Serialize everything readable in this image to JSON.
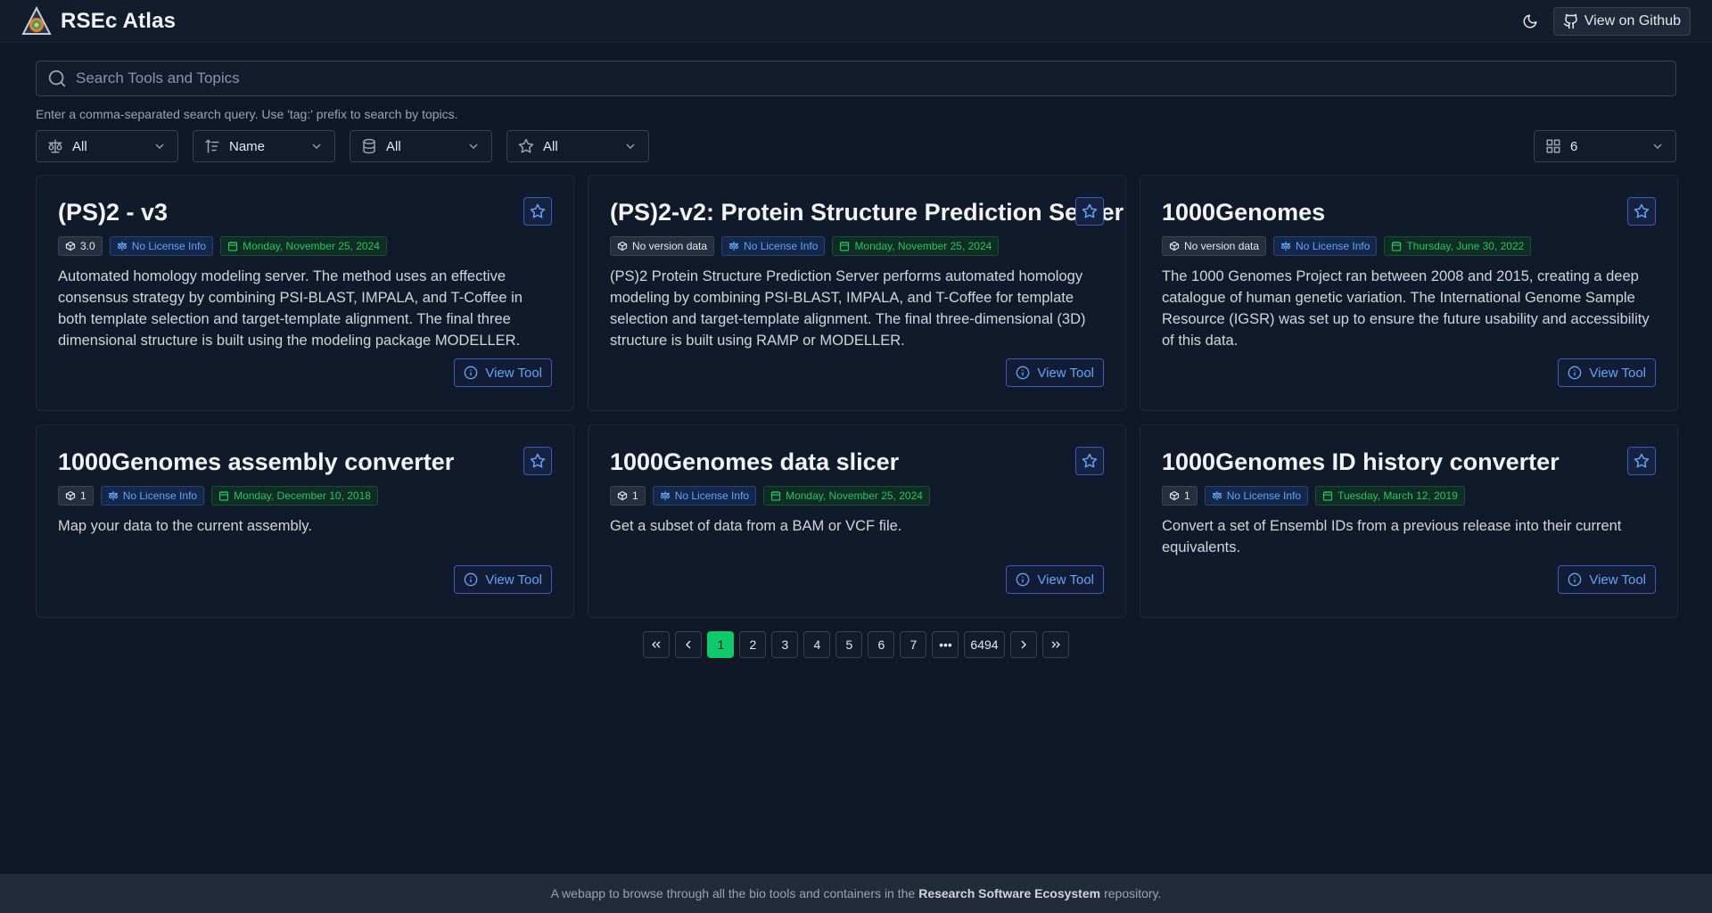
{
  "header": {
    "title": "RSEc Atlas",
    "github_label": "View on Github"
  },
  "search": {
    "placeholder": "Search Tools and Topics",
    "hint": "Enter a comma-separated search query. Use 'tag:' prefix to search by topics."
  },
  "filters": {
    "license": "All",
    "sort": "Name",
    "source": "All",
    "favorites": "All",
    "per_page": "6"
  },
  "cards": [
    {
      "title": "(PS)2 - v3",
      "version": "3.0",
      "license": "No License Info",
      "date": "Monday, November 25, 2024",
      "description": "Automated homology modeling server. The method uses an effective consensus strategy by combining PSI-BLAST, IMPALA, and T-Coffee in both template selection and target-template alignment. The final three dimensional structure is built using the modeling package MODELLER.",
      "action": "View Tool"
    },
    {
      "title": "(PS)2-v2: Protein Structure Prediction Server",
      "version": "No version data",
      "license": "No License Info",
      "date": "Monday, November 25, 2024",
      "description": "(PS)2 Protein Structure Prediction Server performs automated homology modeling by combining PSI-BLAST, IMPALA, and T-Coffee for template selection and target-template alignment. The final three-dimensional (3D) structure is built using RAMP or MODELLER.",
      "action": "View Tool"
    },
    {
      "title": "1000Genomes",
      "version": "No version data",
      "license": "No License Info",
      "date": "Thursday, June 30, 2022",
      "description": "The 1000 Genomes Project ran between 2008 and 2015, creating a deep catalogue of human genetic variation. The International Genome Sample Resource (IGSR) was set up to ensure the future usability and accessibility of this data.",
      "action": "View Tool"
    },
    {
      "title": "1000Genomes assembly converter",
      "version": "1",
      "license": "No License Info",
      "date": "Monday, December 10, 2018",
      "description": "Map your data to the current assembly.",
      "action": "View Tool"
    },
    {
      "title": "1000Genomes data slicer",
      "version": "1",
      "license": "No License Info",
      "date": "Monday, November 25, 2024",
      "description": "Get a subset of data from a BAM or VCF file.",
      "action": "View Tool"
    },
    {
      "title": "1000Genomes ID history converter",
      "version": "1",
      "license": "No License Info",
      "date": "Tuesday, March 12, 2019",
      "description": "Convert a set of Ensembl IDs from a previous release into their current equivalents.",
      "action": "View Tool"
    }
  ],
  "pagination": {
    "pages": [
      "1",
      "2",
      "3",
      "4",
      "5",
      "6",
      "7"
    ],
    "ellipsis": "•••",
    "last": "6494",
    "current": "1"
  },
  "footer": {
    "prefix": "A webapp to browse through all the bio tools and containers in the",
    "link": "Research Software Ecosystem",
    "suffix": "repository."
  },
  "colors": {
    "background": "#101828",
    "accent": "#60a5fa",
    "active_page": "#10c96b",
    "date_badge": "#22c55e"
  }
}
